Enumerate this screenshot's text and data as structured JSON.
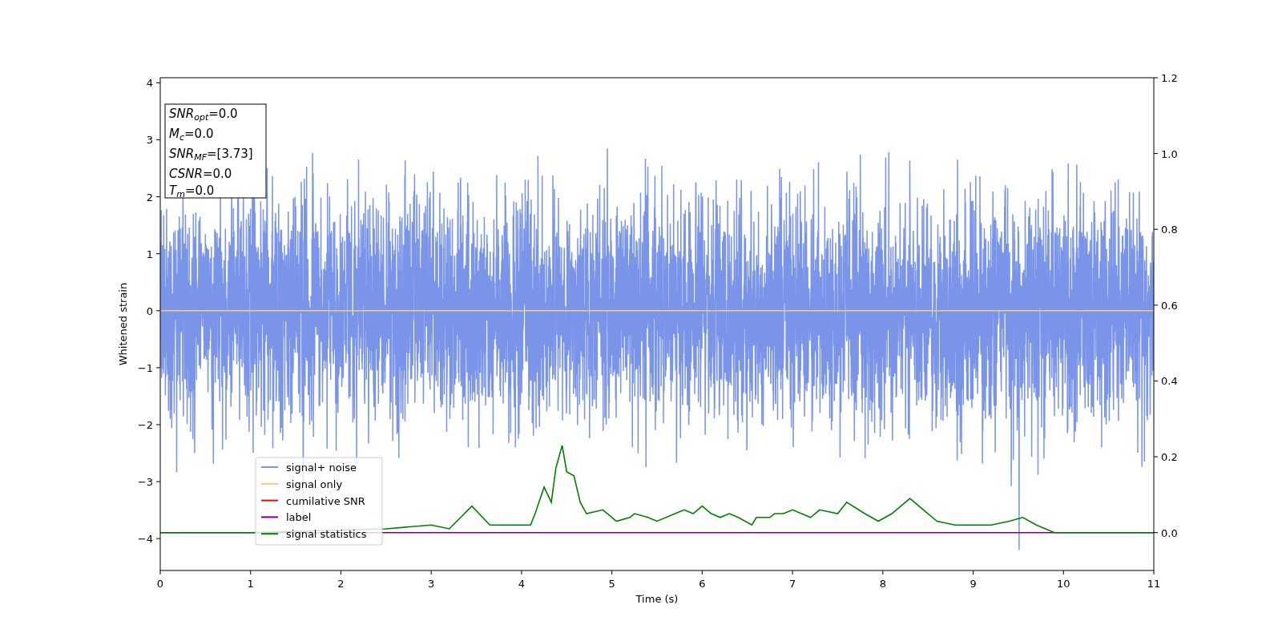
{
  "figure": {
    "annotation_box": [
      "*SNR*$_{opt}$=0.0",
      "*M*$_{c}$=0.0",
      "*SNR*$_{MF}$=[3.73]",
      "*CSNR*=0.0",
      "*T*$_{m}$=0.0"
    ],
    "chart_data": {
      "type": "line",
      "xlabel": "Time (s)",
      "ylabel": "Whitened strain",
      "xlim": [
        0,
        11
      ],
      "ylim": [
        -4.56,
        4.09
      ],
      "y2lim": [
        -0.1,
        1.2
      ],
      "legend": "lower left",
      "xticks": [
        0,
        1,
        2,
        3,
        4,
        5,
        6,
        7,
        8,
        9,
        10,
        11
      ],
      "yticks": [
        {
          "value": -4,
          "label": "−4"
        },
        {
          "value": -3,
          "label": "−3"
        },
        {
          "value": -2,
          "label": "−2"
        },
        {
          "value": -1,
          "label": "−1"
        },
        0,
        1,
        2,
        3,
        4
      ],
      "y2ticks": [
        {
          "value": 0,
          "label": "0.0"
        },
        {
          "value": 0.2,
          "label": "0.2"
        },
        {
          "value": 0.4,
          "label": "0.4"
        },
        {
          "value": 0.6,
          "label": "0.6"
        },
        {
          "value": 0.8,
          "label": "0.8"
        },
        {
          "value": 1.0,
          "label": "1.0"
        },
        {
          "value": 1.2,
          "label": "1.2"
        }
      ],
      "series": [
        {
          "name": "signal+ noise",
          "color": "#7994e8"
        },
        {
          "name": "signal only",
          "color": "#f5c97a",
          "x": [
            0,
            11
          ],
          "values": [
            0,
            0
          ]
        },
        {
          "name": "cumilative SNR",
          "color": "#ff0000"
        },
        {
          "name": "label",
          "color": "#800080",
          "axis": "y2",
          "x": [
            0,
            11
          ],
          "values": [
            0,
            0
          ]
        },
        {
          "name": "signal statistics",
          "color": "#008000",
          "axis": "y2",
          "x": [
            0,
            1,
            2.5,
            3,
            3.2,
            3.45,
            3.65,
            4.0,
            4.1,
            4.15,
            4.25,
            4.33,
            4.38,
            4.45,
            4.5,
            4.58,
            4.65,
            4.72,
            4.9,
            5.05,
            5.2,
            5.25,
            5.4,
            5.5,
            5.7,
            5.8,
            5.9,
            6.0,
            6.1,
            6.2,
            6.3,
            6.4,
            6.55,
            6.6,
            6.75,
            6.8,
            6.9,
            7.0,
            7.1,
            7.2,
            7.3,
            7.5,
            7.6,
            7.8,
            7.95,
            8.1,
            8.3,
            8.45,
            8.6,
            8.8,
            9.0,
            9.2,
            9.4,
            9.55,
            9.7,
            9.9,
            10.2,
            11
          ],
          "values": [
            0,
            0,
            0.01,
            0.02,
            0.01,
            0.07,
            0.02,
            0.02,
            0.02,
            0.05,
            0.12,
            0.08,
            0.17,
            0.23,
            0.16,
            0.15,
            0.08,
            0.05,
            0.06,
            0.03,
            0.04,
            0.05,
            0.04,
            0.03,
            0.05,
            0.06,
            0.05,
            0.07,
            0.05,
            0.04,
            0.05,
            0.04,
            0.02,
            0.04,
            0.04,
            0.05,
            0.05,
            0.06,
            0.05,
            0.04,
            0.06,
            0.05,
            0.08,
            0.05,
            0.03,
            0.05,
            0.09,
            0.06,
            0.03,
            0.02,
            0.02,
            0.02,
            0.03,
            0.04,
            0.02,
            0,
            0,
            0
          ]
        }
      ]
    }
  }
}
